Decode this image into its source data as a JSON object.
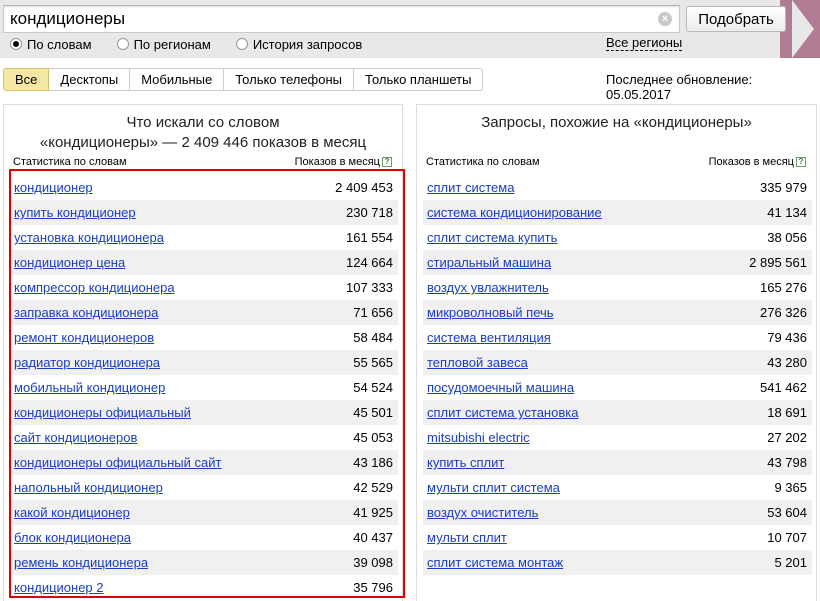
{
  "search": {
    "value": "кондиционеры",
    "submit_label": "Подобрать"
  },
  "modes": [
    {
      "label": "По словам",
      "checked": true
    },
    {
      "label": "По регионам",
      "checked": false
    },
    {
      "label": "История запросов",
      "checked": false
    }
  ],
  "all_regions_label": "Все регионы",
  "tabs": [
    "Все",
    "Десктопы",
    "Мобильные",
    "Только телефоны",
    "Только планшеты"
  ],
  "last_update": "Последнее обновление: 05.05.2017",
  "left": {
    "title_line1": "Что искали со словом",
    "title_line2": "«кондиционеры» — 2 409 446 показов в месяц",
    "col_phrase": "Статистика по словам",
    "col_count": "Показов в месяц",
    "rows": [
      {
        "phrase": "кондиционер",
        "count": "2 409 453"
      },
      {
        "phrase": "купить кондиционер",
        "count": "230 718"
      },
      {
        "phrase": "установка кондиционера",
        "count": "161 554"
      },
      {
        "phrase": "кондиционер цена",
        "count": "124 664"
      },
      {
        "phrase": "компрессор кондиционера",
        "count": "107 333"
      },
      {
        "phrase": "заправка кондиционера",
        "count": "71 656"
      },
      {
        "phrase": "ремонт кондиционеров",
        "count": "58 484"
      },
      {
        "phrase": "радиатор кондиционера",
        "count": "55 565"
      },
      {
        "phrase": "мобильный кондиционер",
        "count": "54 524"
      },
      {
        "phrase": "кондиционеры официальный",
        "count": "45 501"
      },
      {
        "phrase": "сайт кондиционеров",
        "count": "45 053"
      },
      {
        "phrase": "кондиционеры официальный сайт",
        "count": "43 186"
      },
      {
        "phrase": "напольный кондиционер",
        "count": "42 529"
      },
      {
        "phrase": "какой кондиционер",
        "count": "41 925"
      },
      {
        "phrase": "блок кондиционера",
        "count": "40 437"
      },
      {
        "phrase": "ремень кондиционера",
        "count": "39 098"
      },
      {
        "phrase": "кондиционер 2",
        "count": "35 796"
      }
    ]
  },
  "right": {
    "title": "Запросы, похожие на «кондиционеры»",
    "col_phrase": "Статистика по словам",
    "col_count": "Показов в месяц",
    "rows": [
      {
        "phrase": "сплит система",
        "count": "335 979"
      },
      {
        "phrase": "система кондиционирование",
        "count": "41 134"
      },
      {
        "phrase": "сплит система купить",
        "count": "38 056"
      },
      {
        "phrase": "стиральный машина",
        "count": "2 895 561"
      },
      {
        "phrase": "воздух увлажнитель",
        "count": "165 276"
      },
      {
        "phrase": "микроволновый печь",
        "count": "276 326"
      },
      {
        "phrase": "система вентиляция",
        "count": "79 436"
      },
      {
        "phrase": "тепловой завеса",
        "count": "43 280"
      },
      {
        "phrase": "посудомоечный машина",
        "count": "541 462"
      },
      {
        "phrase": "сплит система установка",
        "count": "18 691"
      },
      {
        "phrase": "mitsubishi electric",
        "count": "27 202"
      },
      {
        "phrase": "купить сплит",
        "count": "43 798"
      },
      {
        "phrase": "мульти сплит система",
        "count": "9 365"
      },
      {
        "phrase": "воздух очиститель",
        "count": "53 604"
      },
      {
        "phrase": "мульти сплит",
        "count": "10 707"
      },
      {
        "phrase": "сплит система монтаж",
        "count": "5 201"
      }
    ]
  },
  "colors": {
    "accent_highlight": "#e00000",
    "link": "#1a3dc1",
    "active_tab": "#f6e7a3",
    "brand_band": "#b07c93"
  }
}
